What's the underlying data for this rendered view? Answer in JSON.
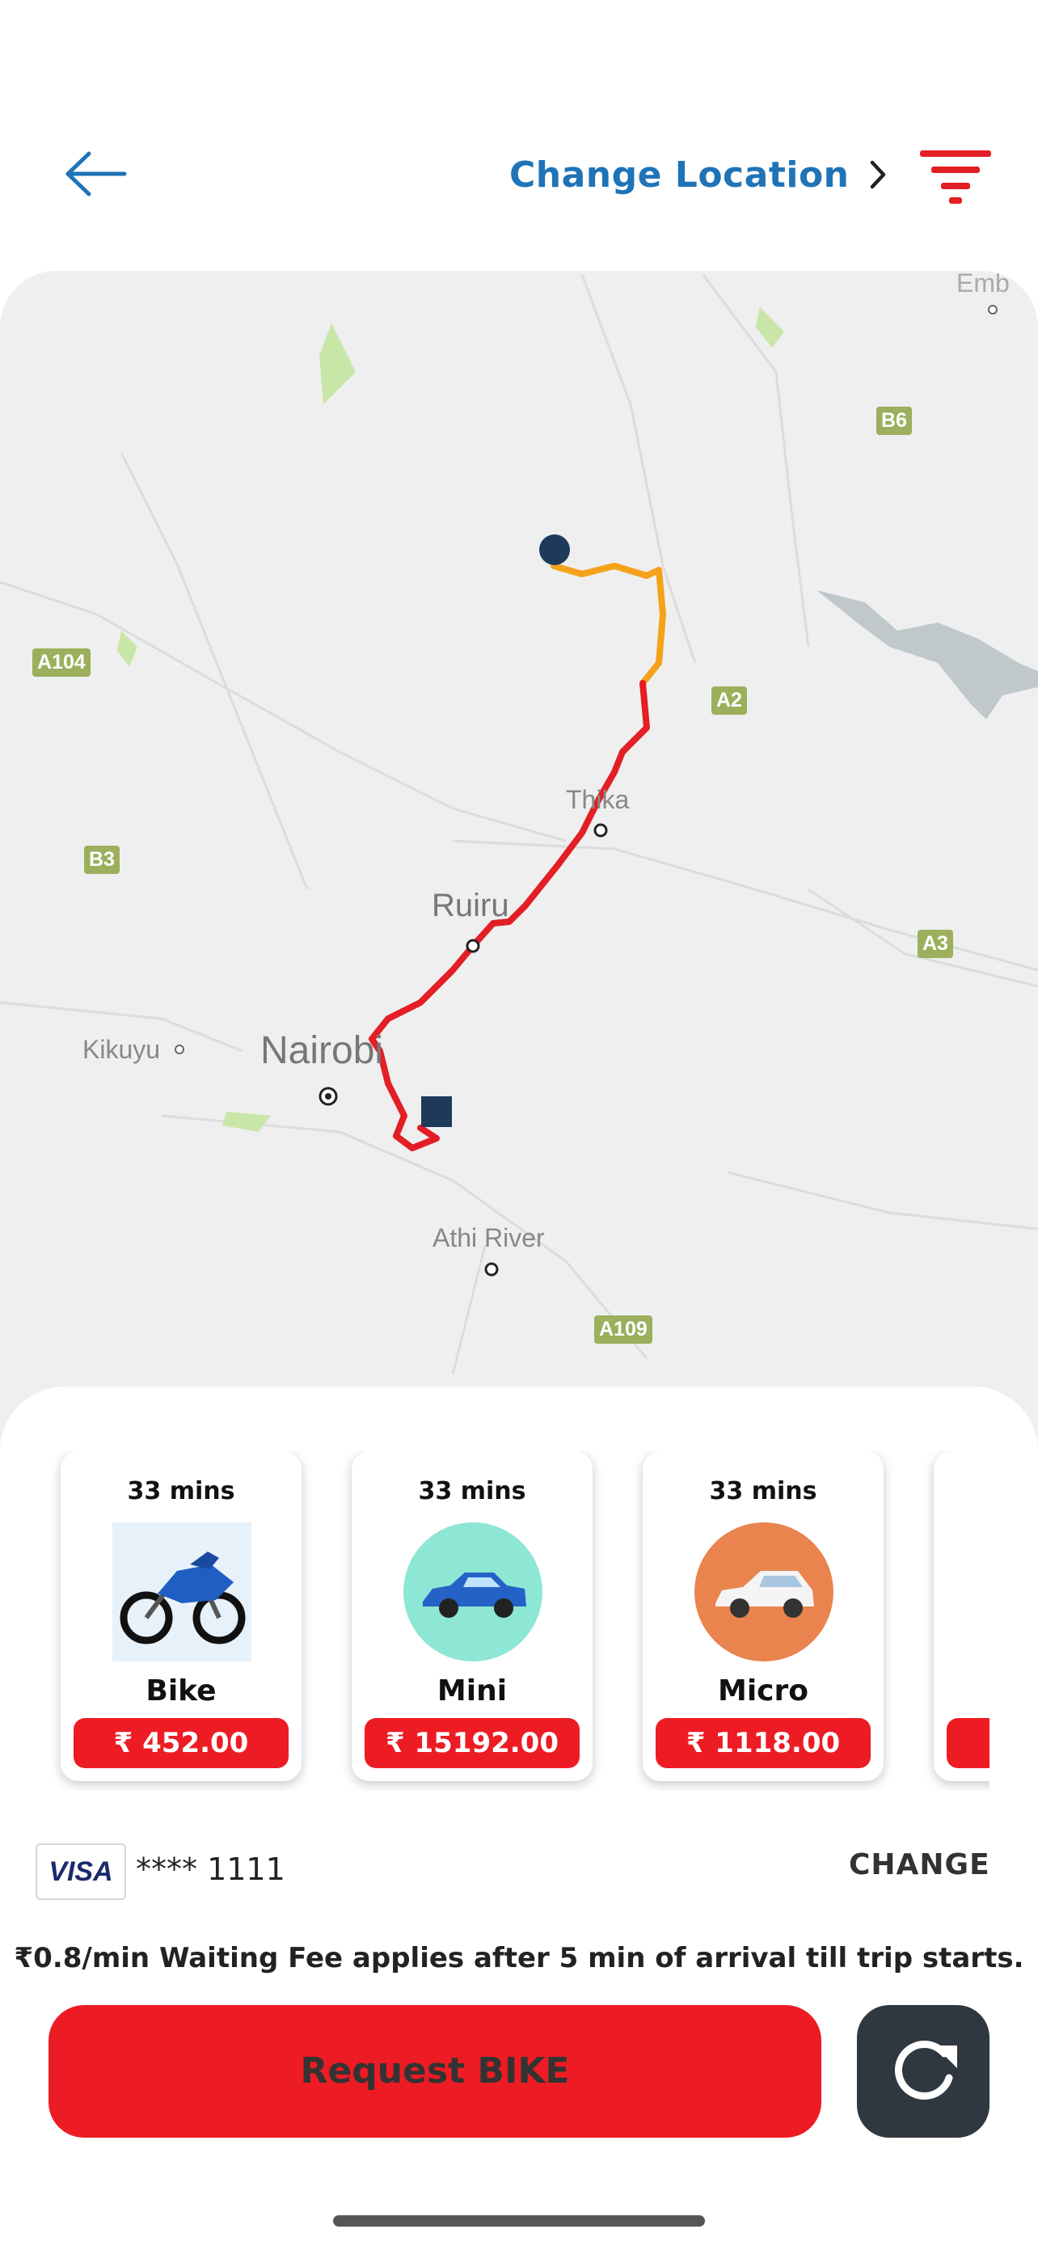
{
  "header": {
    "change_location_label": "Change Location",
    "icons": {
      "back": "arrow-left-icon",
      "chevron": "chevron-right-icon",
      "filter": "filter-icon"
    }
  },
  "map": {
    "places": {
      "nairobi": "Nairobi",
      "ruiru": "Ruiru",
      "thika": "Thika",
      "kikuyu": "Kikuyu",
      "athi_river": "Athi River",
      "emb": "Emb"
    },
    "roads": [
      "A104",
      "B3",
      "B6",
      "A2",
      "A3",
      "A109"
    ],
    "route_colors": {
      "primary": "#e31e24",
      "secondary": "#f5a21b"
    }
  },
  "rides": [
    {
      "eta": "33 mins",
      "name": "Bike",
      "price": "₹ 452.00",
      "icon": "motorbike-icon"
    },
    {
      "eta": "33 mins",
      "name": "Mini",
      "price": "₹ 15192.00",
      "icon": "car-sedan-icon"
    },
    {
      "eta": "33 mins",
      "name": "Micro",
      "price": "₹ 1118.00",
      "icon": "car-hatchback-icon"
    }
  ],
  "payment": {
    "brand": "VISA",
    "masked_number": "**** 1111",
    "change_label": "CHANGE"
  },
  "waiting_fee_text": "₹0.8/min Waiting Fee applies after 5 min of arrival till trip starts.",
  "request_button_label": "Request BIKE",
  "colors": {
    "accent": "#ed1c24",
    "link": "#1f73b7",
    "dark_button": "#2f3740"
  }
}
